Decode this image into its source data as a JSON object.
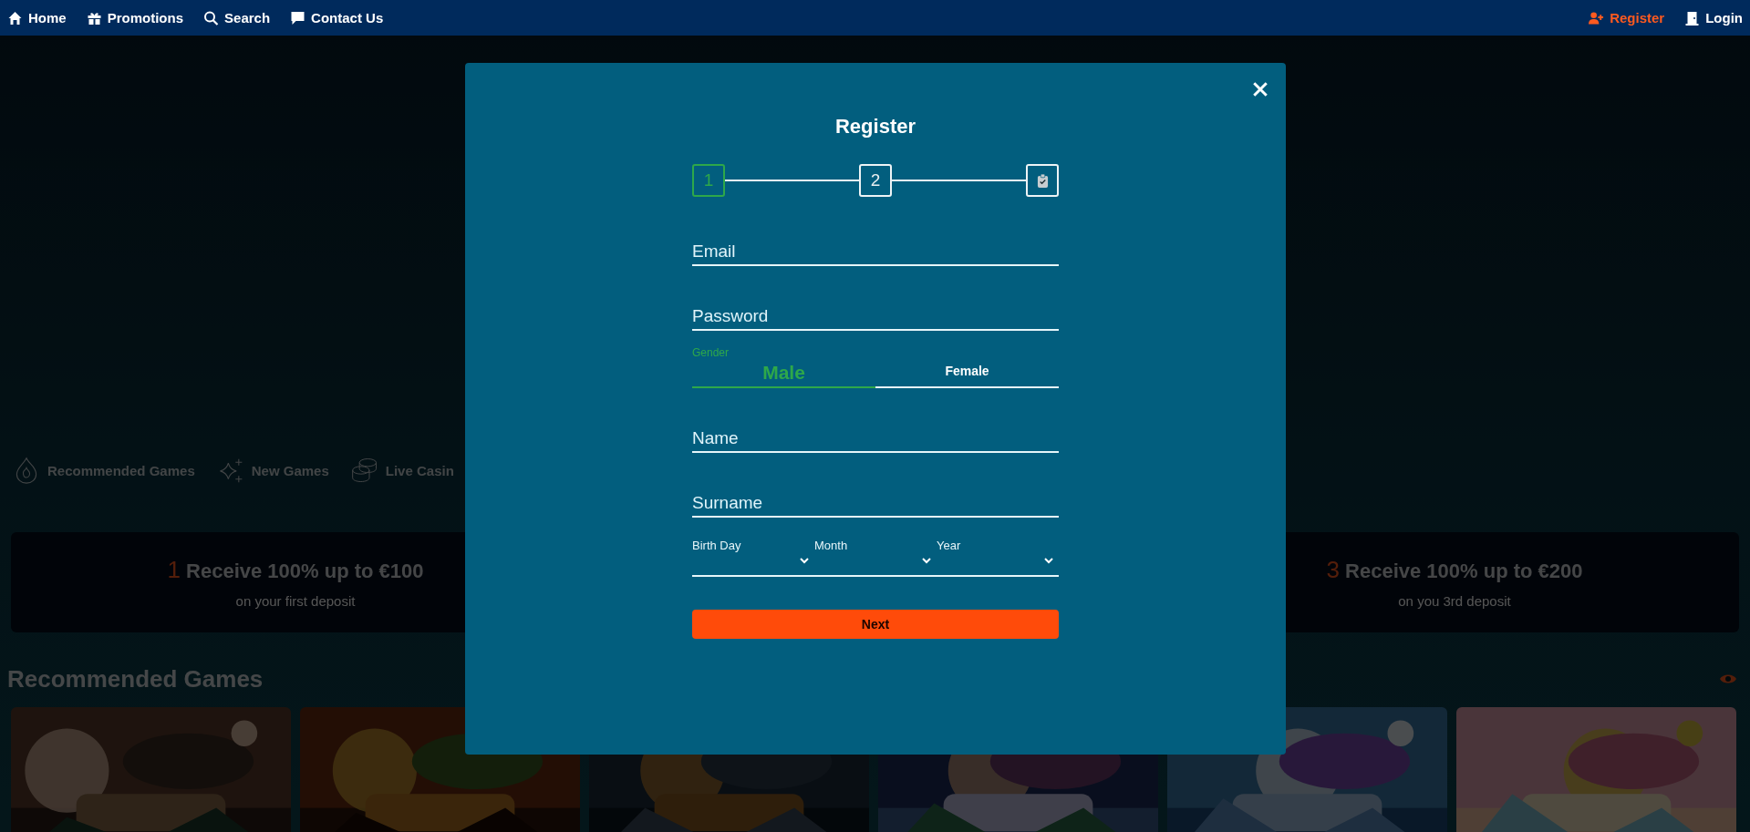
{
  "nav": {
    "left": [
      {
        "label": "Home",
        "kind": "home"
      },
      {
        "label": "Promotions",
        "kind": "gift"
      },
      {
        "label": "Search",
        "kind": "search"
      },
      {
        "label": "Contact Us",
        "kind": "chat"
      }
    ],
    "right": [
      {
        "label": "Register",
        "kind": "register",
        "selected": true
      },
      {
        "label": "Login",
        "kind": "login",
        "selected": false
      }
    ]
  },
  "categories": [
    {
      "label": "Recommended Games",
      "kind": "recommended"
    },
    {
      "label": "New Games",
      "kind": "new"
    },
    {
      "label": "Live Casin",
      "kind": "live"
    }
  ],
  "promos": [
    {
      "number": "1",
      "title": "Receive 100% up to €100",
      "subtitle": "on your first deposit"
    },
    {
      "number": "3",
      "title": "Receive 100% up to €200",
      "subtitle": "on you 3rd deposit"
    }
  ],
  "section_title": "Recommended Games",
  "modal": {
    "title": "Register",
    "steps": [
      {
        "kind": "number",
        "label": "1",
        "selected": true
      },
      {
        "kind": "number",
        "label": "2",
        "selected": false
      },
      {
        "kind": "icon",
        "selected": false
      }
    ],
    "fields": [
      {
        "kind": "text",
        "placeholder": "Email"
      },
      {
        "kind": "text",
        "placeholder": "Password"
      },
      {
        "kind": "gender",
        "label": "Gender",
        "options": [
          {
            "label": "Male",
            "selected": true
          },
          {
            "label": "Female",
            "selected": false
          }
        ]
      },
      {
        "kind": "text",
        "placeholder": "Name"
      },
      {
        "kind": "text",
        "placeholder": "Surname"
      },
      {
        "kind": "date",
        "selects": [
          {
            "label": "Birth Day"
          },
          {
            "label": "Month"
          },
          {
            "label": "Year"
          }
        ]
      }
    ],
    "button": "Next"
  }
}
